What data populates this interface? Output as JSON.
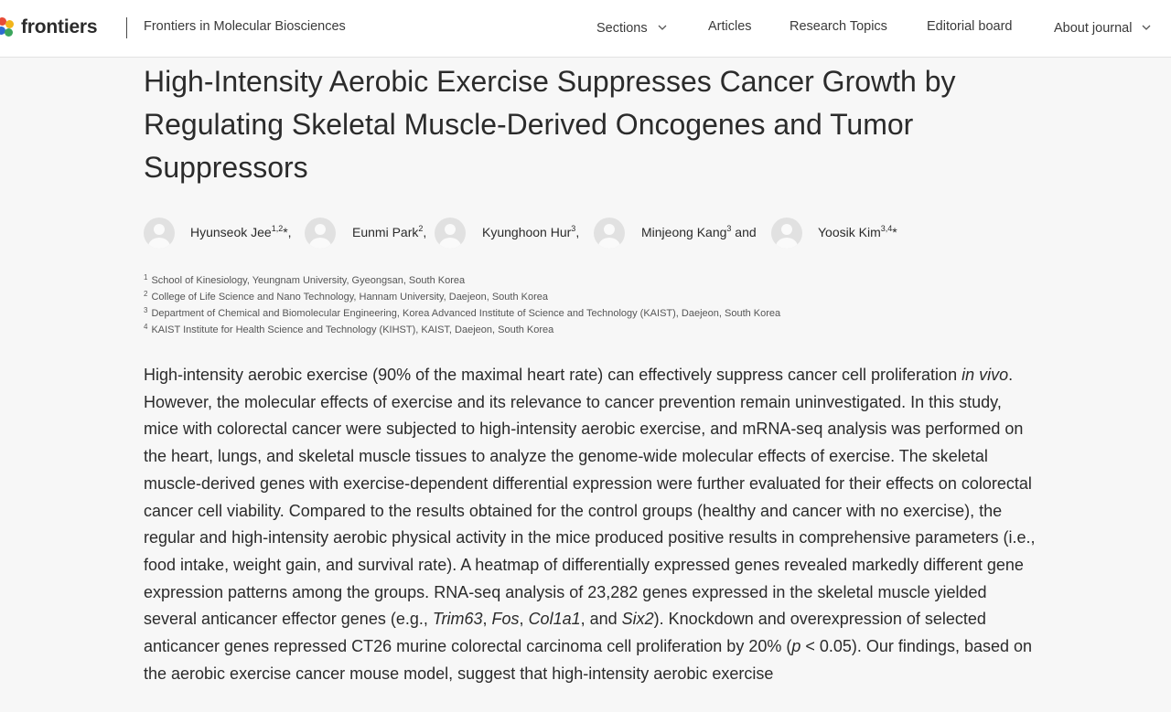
{
  "header": {
    "logo_text": "frontiers",
    "journal_name": "Frontiers in Molecular Biosciences",
    "nav": {
      "sections": "Sections",
      "articles": "Articles",
      "research_topics": "Research Topics",
      "editorial_board": "Editorial board",
      "about_journal": "About journal"
    }
  },
  "article": {
    "title": "High-Intensity Aerobic Exercise Suppresses Cancer Growth by Regulating Skeletal Muscle-Derived Oncogenes and Tumor Suppressors",
    "authors": [
      {
        "name": "Hyunseok Jee",
        "sup": "1,2",
        "suffix": "*,"
      },
      {
        "name": "Eunmi Park",
        "sup": "2",
        "suffix": ","
      },
      {
        "name": "Kyunghoon Hur",
        "sup": "3",
        "suffix": ","
      },
      {
        "name": "Minjeong Kang",
        "sup": "3",
        "suffix": " and"
      },
      {
        "name": "Yoosik Kim",
        "sup": "3,4",
        "suffix": "*"
      }
    ],
    "affiliations": [
      {
        "num": "1",
        "text": "School of Kinesiology, Yeungnam University, Gyeongsan, South Korea"
      },
      {
        "num": "2",
        "text": "College of Life Science and Nano Technology, Hannam University, Daejeon, South Korea"
      },
      {
        "num": "3",
        "text": "Department of Chemical and Biomolecular Engineering, Korea Advanced Institute of Science and Technology (KAIST), Daejeon, South Korea"
      },
      {
        "num": "4",
        "text": "KAIST Institute for Health Science and Technology (KIHST), KAIST, Daejeon, South Korea"
      }
    ],
    "abstract": {
      "p1": "High-intensity aerobic exercise (90% of the maximal heart rate) can effectively suppress cancer cell proliferation ",
      "it1": "in vivo",
      "p2": ". However, the molecular effects of exercise and its relevance to cancer prevention remain uninvestigated. In this study, mice with colorectal cancer were subjected to high-intensity aerobic exercise, and mRNA-seq analysis was performed on the heart, lungs, and skeletal muscle tissues to analyze the genome-wide molecular effects of exercise. The skeletal muscle-derived genes with exercise-dependent differential expression were further evaluated for their effects on colorectal cancer cell viability. Compared to the results obtained for the control groups (healthy and cancer with no exercise), the regular and high-intensity aerobic physical activity in the mice produced positive results in comprehensive parameters (i.e., food intake, weight gain, and survival rate). A heatmap of differentially expressed genes revealed markedly different gene expression patterns among the groups. RNA-seq analysis of 23,282 genes expressed in the skeletal muscle yielded several anticancer effector genes (e.g., ",
      "gene1": "Trim63",
      "sep1": ", ",
      "gene2": "Fos",
      "sep2": ", ",
      "gene3": "Col1a1",
      "sep3": ", and ",
      "gene4": "Six2",
      "p3": "). Knockdown and overexpression of selected anticancer genes repressed CT26 murine colorectal carcinoma cell proliferation by 20% (",
      "pvar": "p",
      "p4": " < 0.05). Our findings, based on the aerobic exercise cancer mouse model, suggest that high-intensity aerobic exercise"
    }
  },
  "colors": {
    "background": "#f7f7f7",
    "header_bg": "#ffffff",
    "text": "#2b2b2b",
    "avatar": "#e1e1e1"
  }
}
